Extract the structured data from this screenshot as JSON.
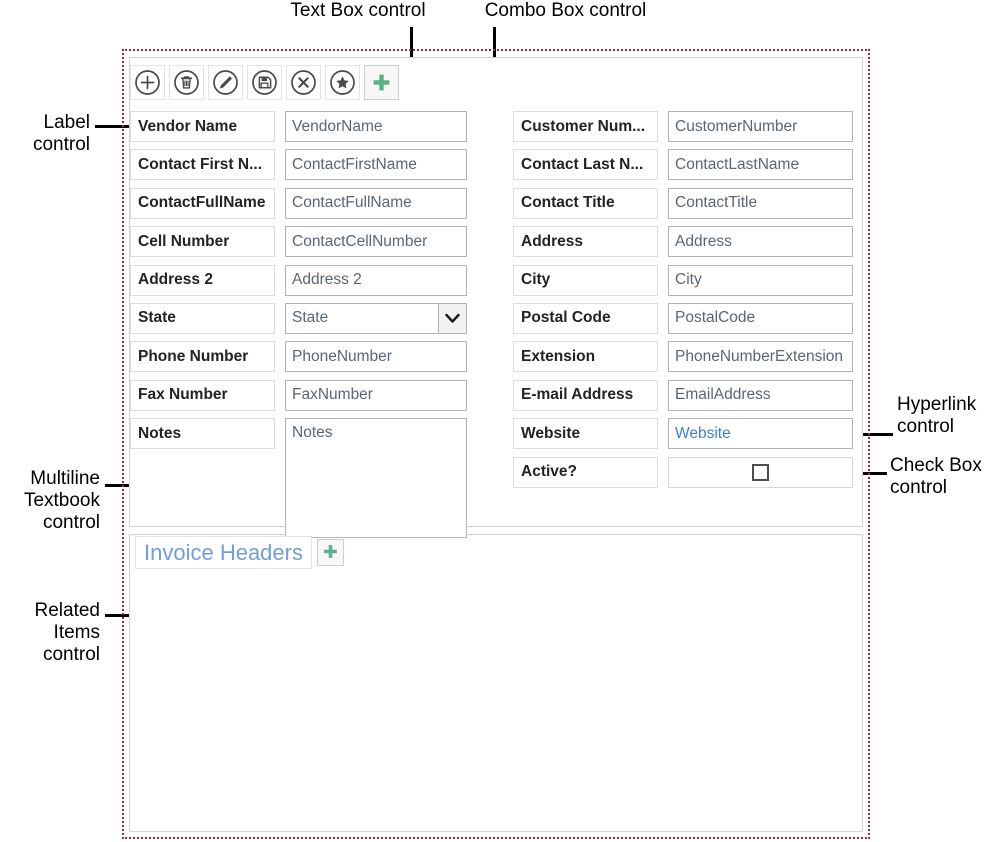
{
  "annotations": [
    {
      "id": "textbox",
      "text": "Text Box control"
    },
    {
      "id": "combobox",
      "text": "Combo Box control"
    },
    {
      "id": "label",
      "text": "Label\ncontrol"
    },
    {
      "id": "multiline",
      "text": "Multiline\nTextbook\ncontrol"
    },
    {
      "id": "related",
      "text": "Related\nItems\ncontrol"
    },
    {
      "id": "hyperlink",
      "text": "Hyperlink\ncontrol"
    },
    {
      "id": "checkbox",
      "text": "Check Box\ncontrol"
    }
  ],
  "toolbar": {
    "buttons": [
      {
        "icon": "circle-plus-icon",
        "name": "new-button"
      },
      {
        "icon": "circle-trash-icon",
        "name": "delete-button"
      },
      {
        "icon": "circle-pencil-icon",
        "name": "edit-button"
      },
      {
        "icon": "circle-save-icon",
        "name": "save-button"
      },
      {
        "icon": "circle-x-icon",
        "name": "cancel-button"
      },
      {
        "icon": "circle-star-icon",
        "name": "favorite-button"
      },
      {
        "icon": "green-plus-icon",
        "name": "add-button"
      }
    ]
  },
  "form": {
    "left_column": [
      {
        "label": "Vendor Name",
        "value": "VendorName",
        "type": "textbox"
      },
      {
        "label": "Contact First N...",
        "value": "ContactFirstName",
        "type": "textbox"
      },
      {
        "label": "ContactFullName",
        "value": "ContactFullName",
        "type": "textbox"
      },
      {
        "label": "Cell Number",
        "value": "ContactCellNumber",
        "type": "textbox"
      },
      {
        "label": "Address 2",
        "value": "Address 2",
        "type": "textbox"
      },
      {
        "label": "State",
        "value": "State",
        "type": "combobox"
      },
      {
        "label": "Phone Number",
        "value": "PhoneNumber",
        "type": "textbox"
      },
      {
        "label": "Fax Number",
        "value": "FaxNumber",
        "type": "textbox"
      },
      {
        "label": "Notes",
        "value": "Notes",
        "type": "multiline"
      }
    ],
    "right_column": [
      {
        "label": "Customer Num...",
        "value": "CustomerNumber",
        "type": "textbox"
      },
      {
        "label": "Contact Last N...",
        "value": "ContactLastName",
        "type": "textbox"
      },
      {
        "label": "Contact Title",
        "value": "ContactTitle",
        "type": "textbox"
      },
      {
        "label": "Address",
        "value": "Address",
        "type": "textbox"
      },
      {
        "label": "City",
        "value": "City",
        "type": "textbox"
      },
      {
        "label": "Postal Code",
        "value": "PostalCode",
        "type": "textbox"
      },
      {
        "label": "Extension",
        "value": "PhoneNumberExtension",
        "type": "textbox"
      },
      {
        "label": "E-mail Address",
        "value": "EmailAddress",
        "type": "textbox"
      },
      {
        "label": "Website",
        "value": "Website",
        "type": "hyperlink"
      },
      {
        "label": "Active?",
        "value": "",
        "type": "checkbox"
      }
    ]
  },
  "related_items": {
    "title": "Invoice Headers",
    "add_icon": "green-plus-icon",
    "rows": []
  },
  "colors": {
    "form_boundary": "#9e2b2b",
    "panel_border": "#d2d2d2",
    "label_text": "#232323",
    "value_text": "#5c6670",
    "link_text": "#3f7fcf",
    "related_title": "#6f9fd8",
    "green_accent": "#5bb18a",
    "icon_stroke": "#4a4a4a"
  }
}
